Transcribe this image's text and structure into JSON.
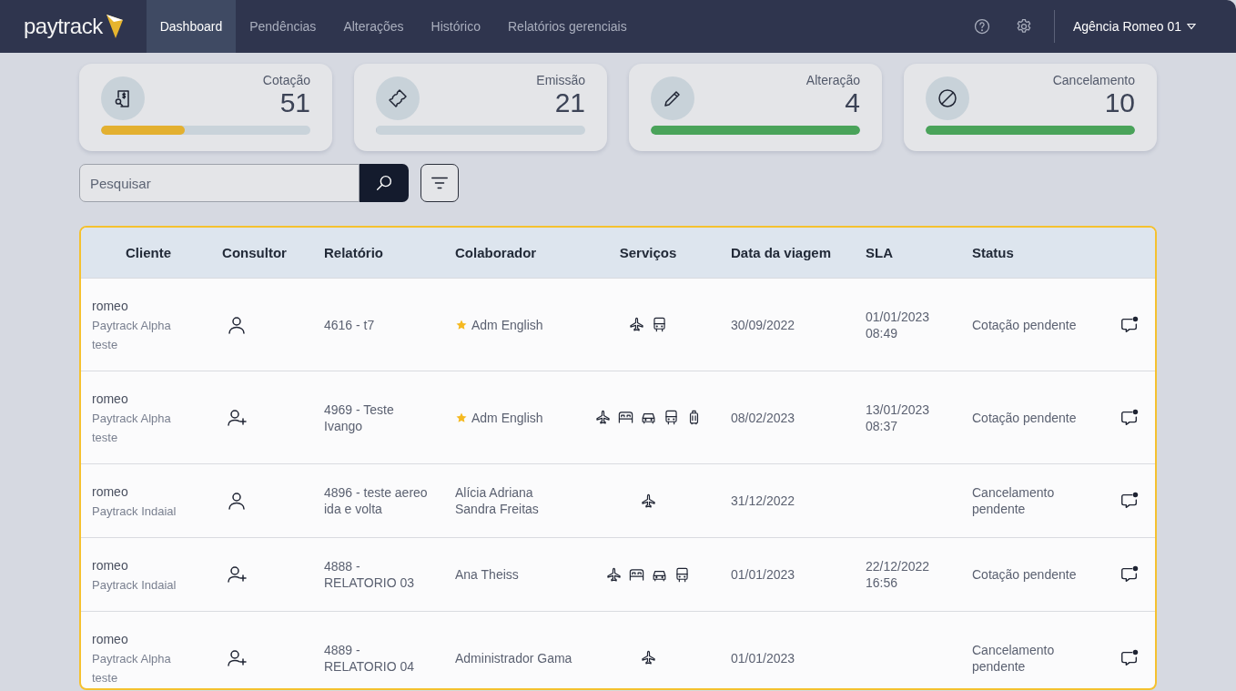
{
  "header": {
    "logo": "paytrack",
    "nav": [
      {
        "label": "Dashboard",
        "selected": true
      },
      {
        "label": "Pendências",
        "selected": false
      },
      {
        "label": "Alterações",
        "selected": false
      },
      {
        "label": "Histórico",
        "selected": false
      },
      {
        "label": "Relatórios gerenciais",
        "selected": false
      }
    ],
    "account": "Agência Romeo 01"
  },
  "cards": [
    {
      "kind": "quote",
      "label": "Cotação",
      "value": "51",
      "level": 0.4,
      "color": "#e3b030"
    },
    {
      "kind": "ticket",
      "label": "Emissão",
      "value": "21",
      "level": 0
    },
    {
      "kind": "edit",
      "label": "Alteração",
      "value": "4",
      "level": 1,
      "color": "#4aa35a"
    },
    {
      "kind": "cancel",
      "label": "Cancelamento",
      "value": "10",
      "level": 1,
      "color": "#4aa35a"
    }
  ],
  "search": {
    "placeholder": "Pesquisar"
  },
  "table": {
    "columns": [
      "Cliente",
      "Consultor",
      "Relatório",
      "Colaborador",
      "Serviços",
      "Data da viagem",
      "SLA",
      "Status"
    ],
    "rows": [
      {
        "client": [
          "romeo",
          "Paytrack Alpha",
          "teste"
        ],
        "consultant": {
          "kind": "person"
        },
        "report": "4616 - t7",
        "collaborator": "Adm English",
        "favorite": true,
        "services": [
          {
            "kind": "plane"
          },
          {
            "kind": "bus"
          }
        ],
        "date": "30/09/2022",
        "sla": "01/01/2023 08:49",
        "status": "Cotação pendente"
      },
      {
        "client": [
          "romeo",
          "Paytrack Alpha",
          "teste"
        ],
        "consultant": {
          "kind": "person-add"
        },
        "report": "4969 - Teste Ivango",
        "collaborator": "Adm English",
        "favorite": true,
        "services": [
          {
            "kind": "plane"
          },
          {
            "kind": "bed"
          },
          {
            "kind": "car"
          },
          {
            "kind": "bus"
          },
          {
            "kind": "luggage"
          }
        ],
        "date": "08/02/2023",
        "sla": "13/01/2023 08:37",
        "status": "Cotação pendente"
      },
      {
        "client": [
          "romeo",
          "Paytrack Indaial"
        ],
        "consultant": {
          "kind": "person"
        },
        "report": "4896 - teste aereo ida e volta",
        "collaborator": "Alícia Adriana Sandra Freitas",
        "favorite": false,
        "services": [
          {
            "kind": "plane"
          }
        ],
        "date": "31/12/2022",
        "status": "Cancelamento pendente"
      },
      {
        "client": [
          "romeo",
          "Paytrack Indaial"
        ],
        "consultant": {
          "kind": "person-add"
        },
        "report": "4888 - RELATORIO 03",
        "collaborator": "Ana Theiss",
        "favorite": false,
        "services": [
          {
            "kind": "plane"
          },
          {
            "kind": "bed"
          },
          {
            "kind": "car"
          },
          {
            "kind": "bus"
          }
        ],
        "date": "01/01/2023",
        "sla": "22/12/2022 16:56",
        "status": "Cotação pendente"
      },
      {
        "client": [
          "romeo",
          "Paytrack Alpha",
          "teste"
        ],
        "consultant": {
          "kind": "person-add"
        },
        "report": "4889 - RELATORIO 04",
        "collaborator": "Administrador Gama",
        "favorite": false,
        "services": [
          {
            "kind": "plane"
          }
        ],
        "date": "01/01/2023",
        "status": "Cancelamento pendente"
      }
    ]
  }
}
